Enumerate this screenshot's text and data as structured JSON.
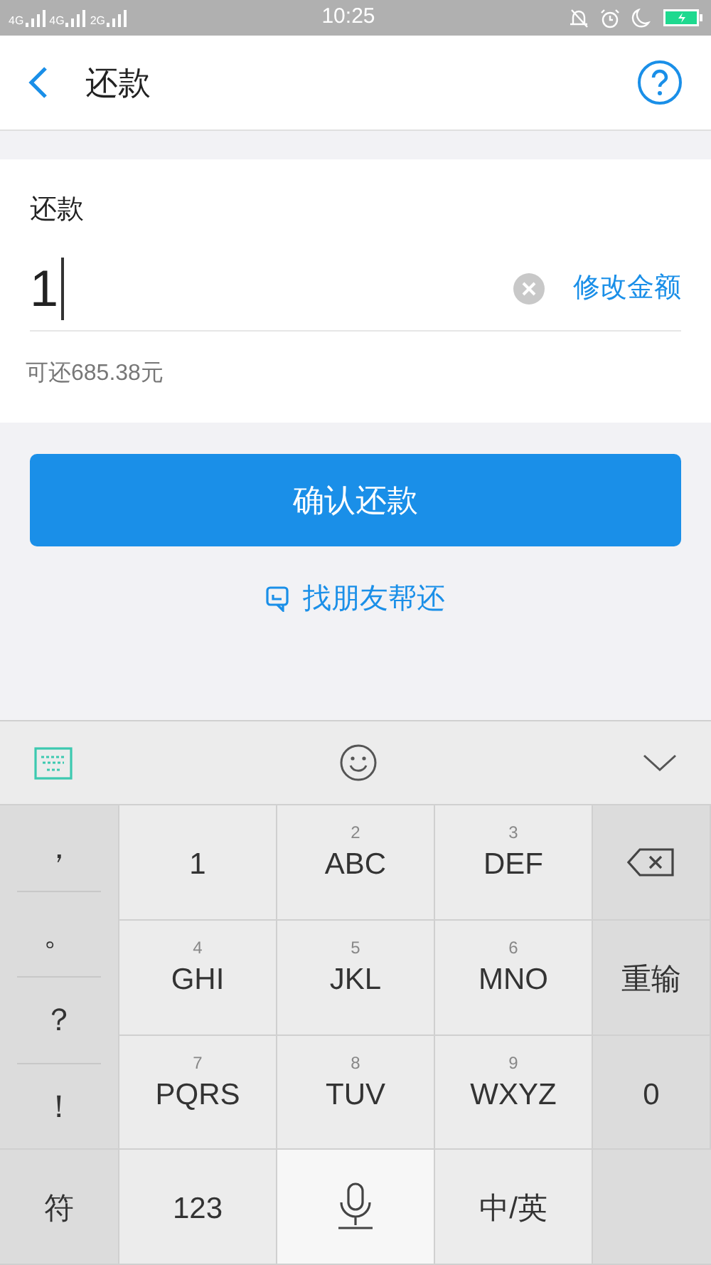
{
  "status_bar": {
    "signal_labels": [
      "4G",
      "4G",
      "2G"
    ],
    "time": "10:25"
  },
  "header": {
    "title": "还款"
  },
  "repay": {
    "label": "还款",
    "amount": "1",
    "edit_link": "修改金额",
    "available": "可还685.38元"
  },
  "confirm_button": "确认还款",
  "friend_link": "找朋友帮还",
  "keyboard": {
    "symbols": [
      "，",
      "。",
      "？",
      "！"
    ],
    "keys": [
      {
        "kind": "digit",
        "main": "1"
      },
      {
        "kind": "digit",
        "hint": "2",
        "main": "ABC"
      },
      {
        "kind": "digit",
        "hint": "3",
        "main": "DEF"
      },
      {
        "kind": "backspace"
      },
      {
        "kind": "digit",
        "hint": "4",
        "main": "GHI"
      },
      {
        "kind": "digit",
        "hint": "5",
        "main": "JKL"
      },
      {
        "kind": "digit",
        "hint": "6",
        "main": "MNO"
      },
      {
        "kind": "function",
        "main": "重输"
      },
      {
        "kind": "digit",
        "hint": "7",
        "main": "PQRS"
      },
      {
        "kind": "digit",
        "hint": "8",
        "main": "TUV"
      },
      {
        "kind": "digit",
        "hint": "9",
        "main": "WXYZ"
      },
      {
        "kind": "function",
        "main": "0"
      }
    ],
    "bottom_row": [
      {
        "kind": "function",
        "main": "符"
      },
      {
        "kind": "digit",
        "main": "123"
      },
      {
        "kind": "mic"
      },
      {
        "kind": "digit",
        "main": "中/英"
      }
    ]
  }
}
